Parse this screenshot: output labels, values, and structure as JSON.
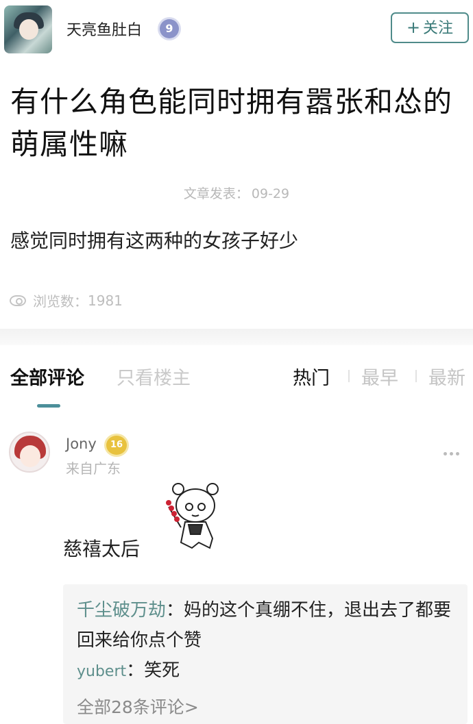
{
  "author": {
    "name": "天亮鱼肚白",
    "level": "9",
    "follow_label": "关注",
    "follow_icon": "+"
  },
  "post": {
    "title": "有什么角色能同时拥有嚣张和怂的萌属性嘛",
    "date_label": "文章发表：",
    "date": "09-29",
    "body": "感觉同时拥有这两种的女孩子好少",
    "views_label": "浏览数：",
    "views": "1981"
  },
  "tabs": {
    "all": "全部评论",
    "op_only": "只看楼主",
    "hot": "热门",
    "earliest": "最早",
    "newest": "最新"
  },
  "comment": {
    "user": "Jony",
    "level": "16",
    "location": "来自广东",
    "text": "慈禧太后",
    "replies": [
      {
        "name": "千尘破万劫",
        "sep": "：",
        "text": "妈的这个真绷不住，退出去了都要回来给你点个赞"
      },
      {
        "name": "yubert",
        "sep": "：",
        "text": "笑死"
      }
    ],
    "reply_count_text": "全部28条评论",
    "reply_count_arrow": ">"
  },
  "colors": {
    "accent": "#4c8f9a",
    "reply_name": "#5e8f8c",
    "level_badge_author": "#8b93c9",
    "level_badge_comment": "#e8c23e"
  }
}
